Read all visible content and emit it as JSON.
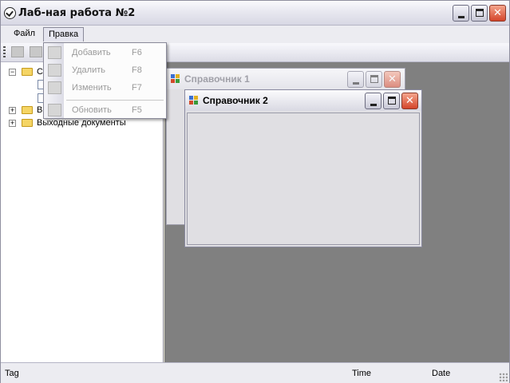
{
  "window": {
    "title": "Лаб-ная работа №2"
  },
  "menu": [
    {
      "label": "Файл"
    },
    {
      "label": "Правка"
    }
  ],
  "edit_menu": {
    "items": [
      {
        "label": "Добавить",
        "shortcut": "F6",
        "icon": "add-record-icon"
      },
      {
        "label": "Удалить",
        "shortcut": "F8",
        "icon": "delete-record-icon"
      },
      {
        "label": "Изменить",
        "shortcut": "F7",
        "icon": "edit-record-icon"
      },
      {
        "label": "Обновить",
        "shortcut": "F5",
        "icon": "refresh-icon"
      }
    ]
  },
  "tree": {
    "nodes": [
      {
        "label": "С",
        "expanded": true
      },
      {
        "label": "В",
        "expanded": false
      },
      {
        "label": "Выходные документы",
        "expanded": false
      }
    ]
  },
  "child_windows": [
    {
      "title": "Справочник 1",
      "active": false
    },
    {
      "title": "Справочник 2",
      "active": true
    }
  ],
  "statusbar": {
    "tag": "Tag",
    "time": "Time",
    "date": "Date"
  },
  "colors": {
    "mdi_background": "#808080",
    "client": "#e0dfe3"
  }
}
